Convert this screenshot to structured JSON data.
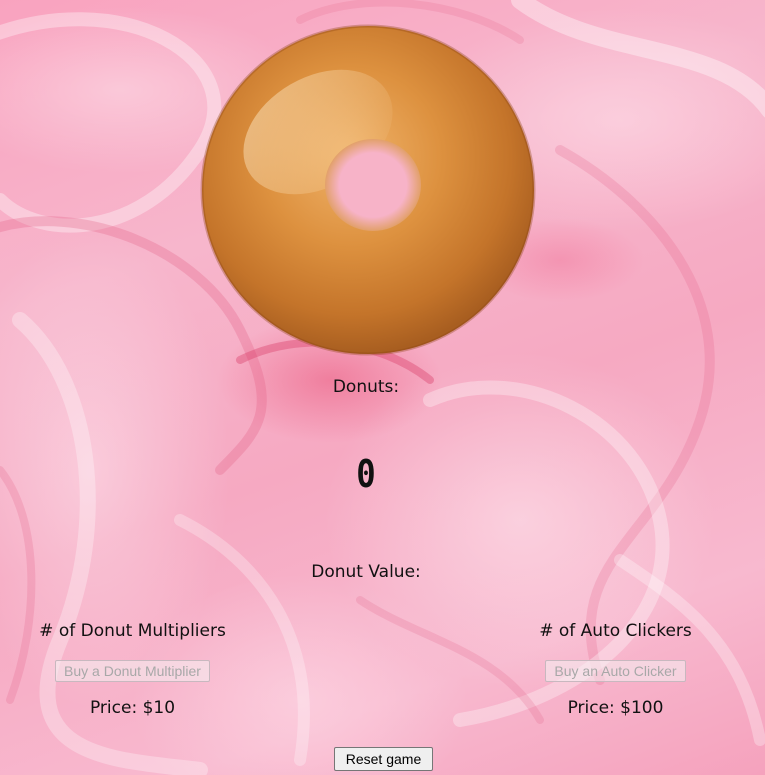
{
  "stats": {
    "donuts_label": "Donuts:",
    "donut_count": "0",
    "donut_value_label": "Donut Value:"
  },
  "multipliers": {
    "title": "# of Donut Multipliers",
    "buy_label": "Buy a Donut Multiplier",
    "price": "Price: $10"
  },
  "auto_clickers": {
    "title": "# of Auto Clickers",
    "buy_label": "Buy an Auto Clicker",
    "price": "Price: $100"
  },
  "reset": {
    "label": "Reset game"
  },
  "theme": {
    "frosting_color": "#f7b0c8",
    "donut_color": "#d98a3a"
  }
}
